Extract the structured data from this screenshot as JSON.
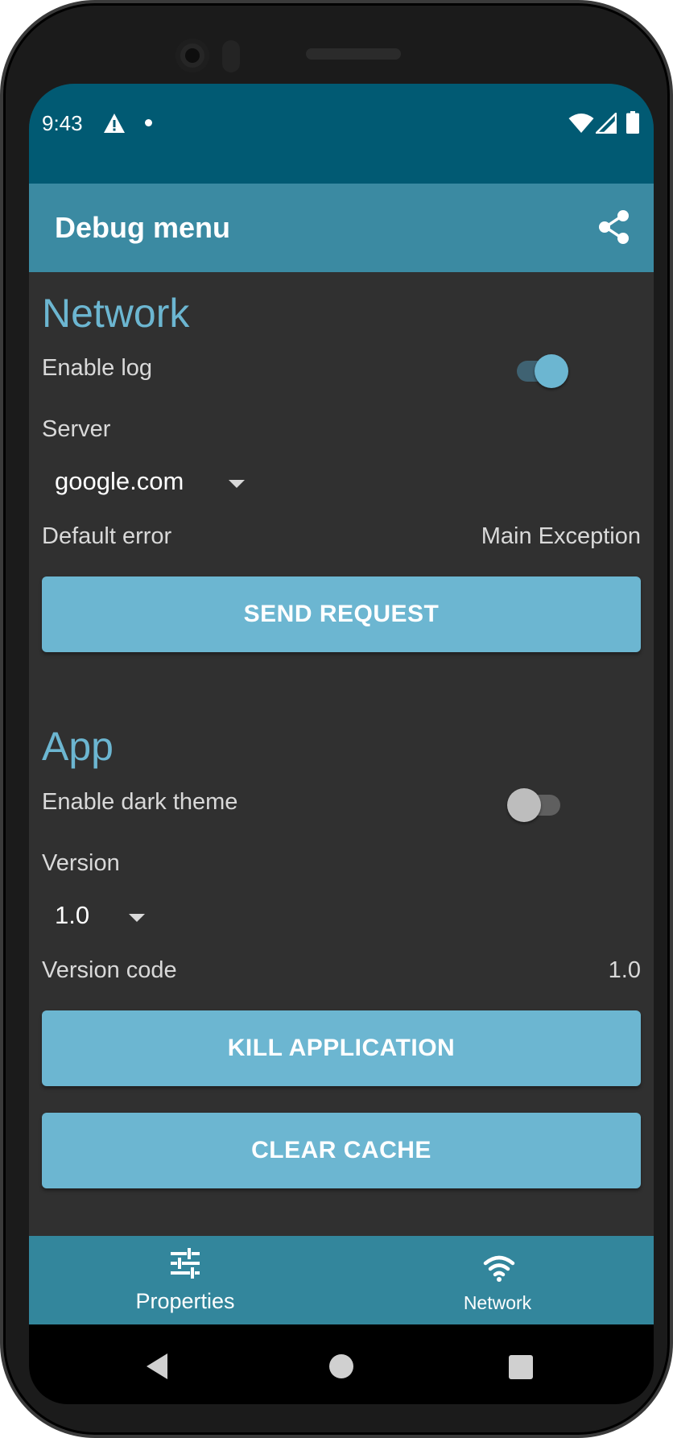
{
  "status_bar": {
    "time": "9:43",
    "icons": [
      "alert-icon",
      "notification-dot-icon",
      "wifi-icon",
      "cell-signal-icon",
      "battery-icon"
    ]
  },
  "app_bar": {
    "title": "Debug menu",
    "action_icon": "share-icon"
  },
  "network_section": {
    "title": "Network",
    "enable_log_label": "Enable log",
    "enable_log_on": true,
    "server_label": "Server",
    "server_value": "google.com",
    "default_error_label": "Default error",
    "default_error_value": "Main Exception",
    "send_request_label": "SEND REQUEST"
  },
  "app_section": {
    "title": "App",
    "dark_theme_label": "Enable dark theme",
    "dark_theme_on": false,
    "version_label": "Version",
    "version_value": "1.0",
    "version_code_label": "Version code",
    "version_code_value": "1.0",
    "kill_app_label": "KILL APPLICATION",
    "clear_cache_label": "CLEAR CACHE"
  },
  "bottom_nav": {
    "items": [
      {
        "label": "Properties",
        "icon": "tune-sliders-icon",
        "selected": true
      },
      {
        "label": "Network",
        "icon": "wifi-icon",
        "selected": false
      }
    ]
  },
  "system_nav": {
    "buttons": [
      "back-icon",
      "home-icon",
      "recents-icon"
    ]
  },
  "colors": {
    "status_bar": "#015a73",
    "app_bar": "#3b8aa2",
    "accent": "#6cb6d1",
    "background": "#303030",
    "bottom_nav": "#33869c"
  }
}
